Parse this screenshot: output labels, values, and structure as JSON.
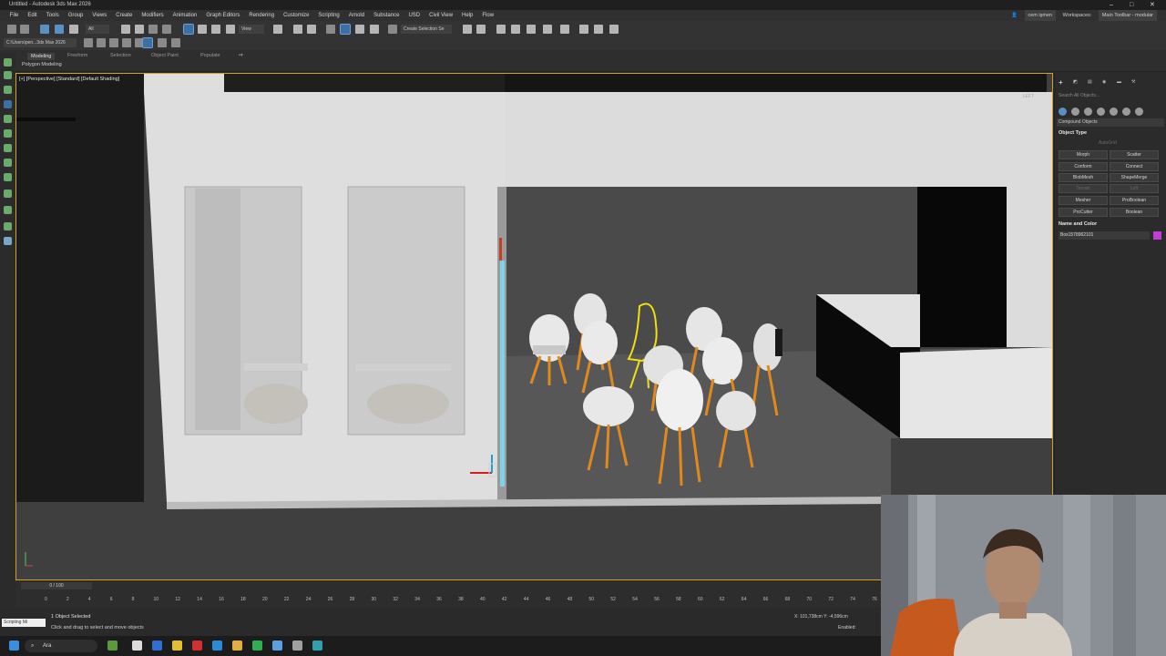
{
  "window": {
    "title": "Untitled - Autodesk 3ds Max 2026"
  },
  "menu": {
    "items": [
      "File",
      "Edit",
      "Tools",
      "Group",
      "Views",
      "Create",
      "Modifiers",
      "Animation",
      "Graph Editors",
      "Rendering",
      "Customize",
      "Scripting",
      "Arnold",
      "Substance",
      "USD",
      "Civil View",
      "Help",
      "Flow"
    ],
    "user": "cem işmen",
    "workspaces_label": "Workspaces:",
    "workspace_value": "Main Toolbar - modular"
  },
  "toolbar": {
    "filter_dropdown": "All",
    "view_dropdown": "View",
    "selection_set": "Create Selection Se",
    "path": "C:\\Users\\pen...3ds Max 2026"
  },
  "ribbon": {
    "tabs": [
      "Modeling",
      "Freeform",
      "Selection",
      "Object Paint",
      "Populate"
    ],
    "active_tab": "Modeling",
    "subpanel": "Polygon Modeling"
  },
  "viewport": {
    "label": "[+] [Perspective] [Standard] [Default Shading]",
    "corner": "LEFT"
  },
  "command_panel": {
    "search_placeholder": "Search All Objects...",
    "dropdown": "Compound Objects",
    "object_type_header": "Object Type",
    "autogrid": "AutoGrid",
    "buttons": [
      "Morph",
      "Scatter",
      "Conform",
      "Connect",
      "BlobMesh",
      "ShapeMerge",
      "Terrain",
      "Loft",
      "Mesher",
      "ProBoolean",
      "ProCutter",
      "Boolean"
    ],
    "name_color_header": "Name and Color",
    "object_name": "Box1578962101",
    "object_color": "#c23dd6"
  },
  "timeline": {
    "slider": "0 / 100",
    "ticks": [
      "0",
      "2",
      "4",
      "6",
      "8",
      "10",
      "12",
      "14",
      "16",
      "18",
      "20",
      "22",
      "24",
      "26",
      "28",
      "30",
      "32",
      "34",
      "36",
      "38",
      "40",
      "42",
      "44",
      "46",
      "48",
      "50",
      "52",
      "54",
      "56",
      "58",
      "60",
      "62",
      "64",
      "66",
      "68",
      "70",
      "72",
      "74",
      "76",
      "78"
    ]
  },
  "status": {
    "selected": "1 Object Selected",
    "hint": "Click and drag to select and move objects",
    "maxscript": "Scripting Mi",
    "coords": "X: 101,738cm  Y: -4,596cm",
    "enabled": "Enabled:"
  },
  "taskbar": {
    "search": "Ara"
  },
  "colors": {
    "accent": "#5a8fc4",
    "selection_highlight": "#f0e010",
    "viewport_border": "#d4a020",
    "chair_legs": "#e08a1e"
  }
}
